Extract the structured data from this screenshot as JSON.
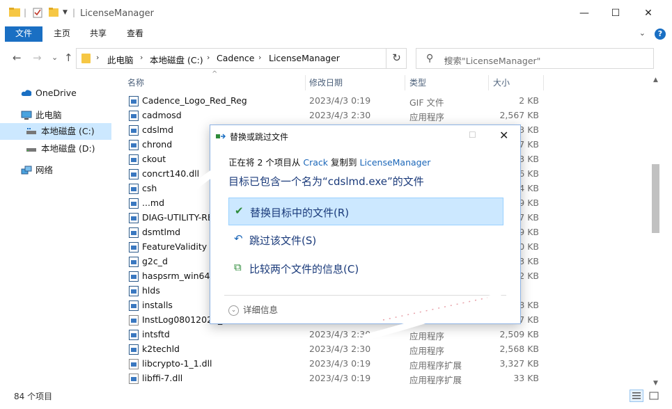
{
  "window": {
    "title": "LicenseManager",
    "minimize_glyph": "—",
    "maximize_glyph": "☐",
    "close_glyph": "✕"
  },
  "ribbon": {
    "tabs": [
      "文件",
      "主页",
      "共享",
      "查看"
    ],
    "help_glyph": "?",
    "collapse_glyph": "⌄"
  },
  "nav": {
    "back": "←",
    "forward": "→",
    "recent": "⌄",
    "up": "↑",
    "breadcrumbs": [
      "此电脑",
      "本地磁盘 (C:)",
      "Cadence",
      "LicenseManager"
    ],
    "separator": "›",
    "dropdown": "⌄",
    "refresh": "↻",
    "search_placeholder": "搜索\"LicenseManager\"",
    "search_icon": "⚲"
  },
  "sidebar": {
    "items": [
      {
        "label": "OneDrive",
        "icon": "cloud-icon"
      },
      {
        "label": "此电脑",
        "icon": "computer-icon"
      },
      {
        "label": "本地磁盘 (C:)",
        "icon": "drive-icon"
      },
      {
        "label": "本地磁盘 (D:)",
        "icon": "drive-icon"
      },
      {
        "label": "网络",
        "icon": "network-icon"
      }
    ]
  },
  "columns": {
    "name": "名称",
    "date": "修改日期",
    "type": "类型",
    "size": "大小",
    "sort_glyph": "^"
  },
  "files": [
    {
      "name": "Cadence_Logo_Red_Reg",
      "date": "2023/4/3 0:19",
      "type": "GIF 文件",
      "size": "2 KB"
    },
    {
      "name": "cadmosd",
      "date": "2023/4/3 2:30",
      "type": "应用程序",
      "size": "2,567 KB"
    },
    {
      "name": "cdslmd",
      "date": "",
      "type": "",
      "size": "3 KB"
    },
    {
      "name": "chrond",
      "date": "",
      "type": "",
      "size": "7 KB"
    },
    {
      "name": "ckout",
      "date": "",
      "type": "",
      "size": "3 KB"
    },
    {
      "name": "concrt140.dll",
      "date": "",
      "type": "",
      "size": "6 KB"
    },
    {
      "name": "csh",
      "date": "",
      "type": "",
      "size": "4 KB"
    },
    {
      "name": "...md",
      "date": "",
      "type": "",
      "size": "9 KB"
    },
    {
      "name": "DIAG-UTILITY-RE",
      "date": "",
      "type": "",
      "size": "7 KB"
    },
    {
      "name": "dsmtlmd",
      "date": "",
      "type": "",
      "size": "9 KB"
    },
    {
      "name": "FeatureValidity",
      "date": "",
      "type": "",
      "size": "0 KB"
    },
    {
      "name": "g2c_d",
      "date": "",
      "type": "",
      "size": "3 KB"
    },
    {
      "name": "haspsrm_win64.d",
      "date": "",
      "type": "",
      "size": "2 KB"
    },
    {
      "name": "hlds",
      "date": "",
      "type": "",
      "size": ""
    },
    {
      "name": "installs",
      "date": "",
      "type": "",
      "size": "8 KB"
    },
    {
      "name": "InstLog08012023_",
      "date": "",
      "type": "",
      "size": "7 KB"
    },
    {
      "name": "intsftd",
      "date": "2023/4/3 2:30",
      "type": "应用程序",
      "size": "2,509 KB"
    },
    {
      "name": "k2techld",
      "date": "2023/4/3 2:30",
      "type": "应用程序",
      "size": "2,568 KB"
    },
    {
      "name": "libcrypto-1_1.dll",
      "date": "2023/4/3 0:19",
      "type": "应用程序扩展",
      "size": "3,327 KB"
    },
    {
      "name": "libffi-7.dll",
      "date": "2023/4/3 0:19",
      "type": "应用程序扩展",
      "size": "33 KB"
    }
  ],
  "status": {
    "count": "84 个项目"
  },
  "dialog": {
    "title": "替换或跳过文件",
    "maximize_glyph": "☐",
    "close_glyph": "✕",
    "line_prefix": "正在将 2 个项目从",
    "source": "Crack",
    "line_middle": "复制到",
    "destination": "LicenseManager",
    "heading": "目标已包含一个名为“cdslmd.exe”的文件",
    "options": [
      {
        "label": "替换目标中的文件(R)",
        "icon": "✔",
        "icon_color": "#2e8b3a"
      },
      {
        "label": "跳过该文件(S)",
        "icon": "↶",
        "icon_color": "#1a66b8"
      },
      {
        "label": "比较两个文件的信息(C)",
        "icon": "⧉",
        "icon_color": "#2e8b3a"
      }
    ],
    "details_label": "详细信息",
    "details_glyph": "⌄"
  },
  "colors": {
    "accent": "#1a6fc3",
    "selection": "#cce8ff",
    "link": "#1a66b8",
    "dialog_text": "#1a3a7a"
  }
}
